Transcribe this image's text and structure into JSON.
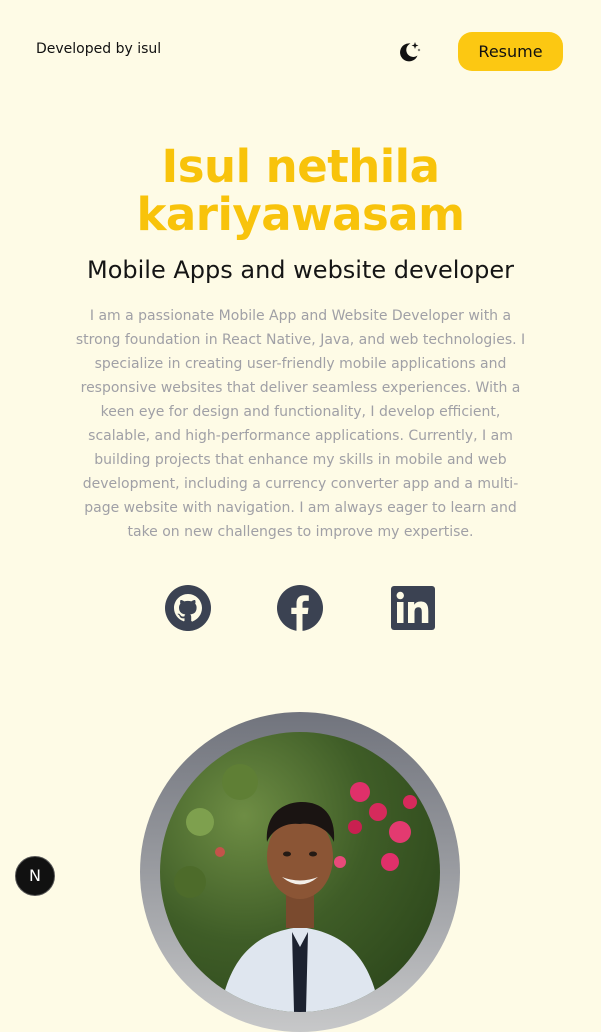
{
  "header": {
    "brand": "Developed by isul",
    "theme_toggle_icon": "moon-stars-icon",
    "resume_label": "Resume",
    "accent_color": "#fcc812"
  },
  "hero": {
    "name_line1": "Isul nethila",
    "name_line2": "kariyawasam",
    "role": "Mobile Apps and website developer",
    "bio": "I am a passionate Mobile App and Website Developer with a strong foundation in React Native, Java, and web technologies. I specialize in creating user-friendly mobile applications and responsive websites that deliver seamless experiences. With a keen eye for design and functionality, I develop efficient, scalable, and high-performance applications. Currently, I am building projects that enhance my skills in mobile and web development, including a currency converter app and a multi-page website with navigation. I am always eager to learn and take on new challenges to improve my expertise."
  },
  "social": [
    {
      "icon": "github-icon"
    },
    {
      "icon": "facebook-icon"
    },
    {
      "icon": "linkedin-icon"
    }
  ],
  "profile": {
    "icon": "profile-photo"
  },
  "dev_badge": {
    "label": "N",
    "icon": "nextjs-icon"
  },
  "colors": {
    "background": "#fefbe6",
    "name": "#f8c30b",
    "bio": "#a0a0a6",
    "social": "#3b4252"
  }
}
